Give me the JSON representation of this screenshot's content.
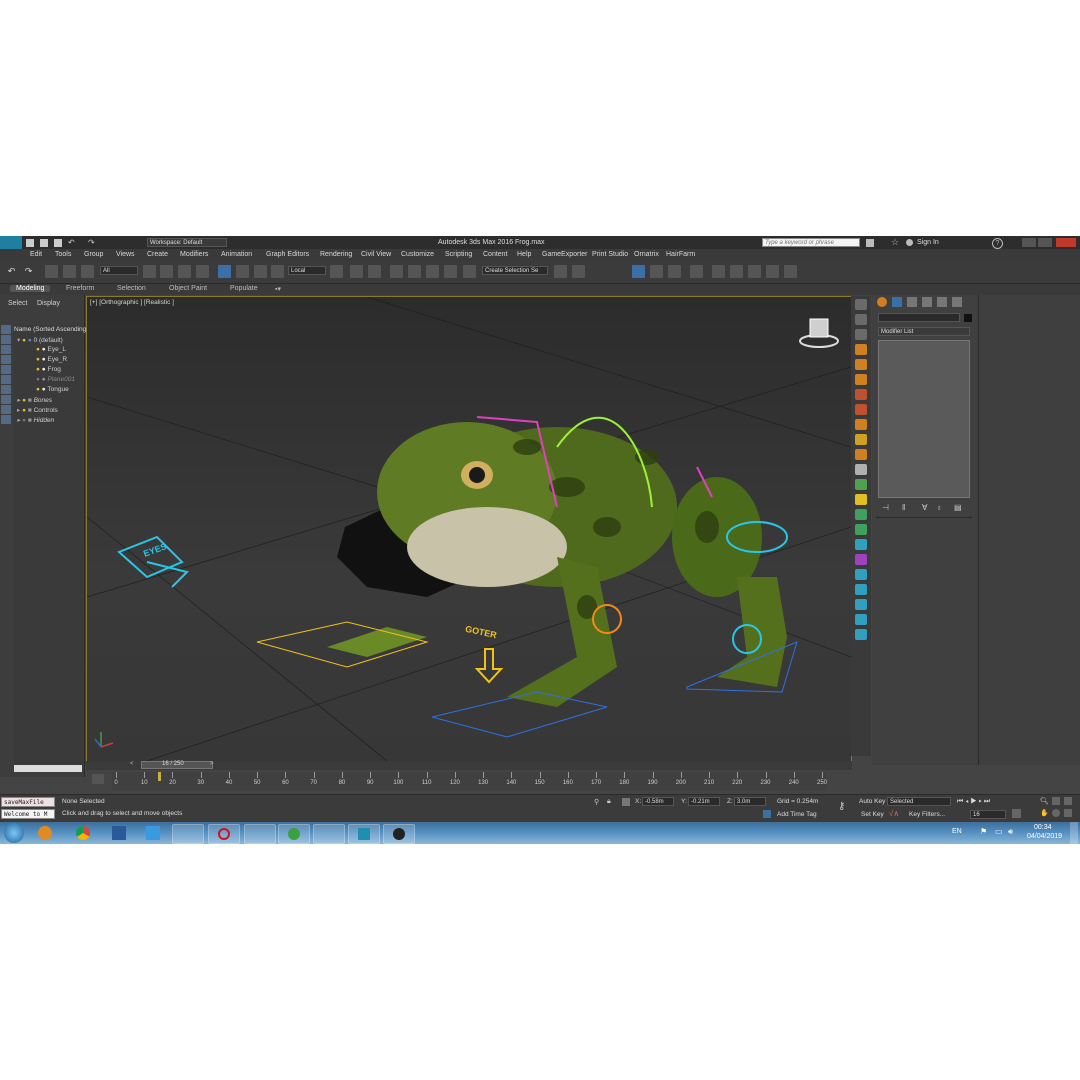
{
  "titlebar": {
    "workspace_label": "Workspace: Default",
    "app_title": "Autodesk 3ds Max 2016",
    "file_name": "Frog.max",
    "search_placeholder": "Type a keyword or phrase",
    "sign_in": "Sign In"
  },
  "menu": [
    "Edit",
    "Tools",
    "Group",
    "Views",
    "Create",
    "Modifiers",
    "Animation",
    "Graph Editors",
    "Rendering",
    "Civil View",
    "Customize",
    "Scripting",
    "Content",
    "Help",
    "GameExporter",
    "Print Studio",
    "Ornatrix",
    "HairFarm"
  ],
  "toolbar": {
    "selection_filter": "All",
    "coordinate_system": "Local",
    "selection_set": "Create Selection Se"
  },
  "ribbon": {
    "tabs": [
      "Modeling",
      "Freeform",
      "Selection",
      "Object Paint",
      "Populate"
    ]
  },
  "scene_explorer": {
    "tabs": [
      "Select",
      "Display"
    ],
    "header": "Name (Sorted Ascending)",
    "items": [
      "0 (default)",
      "Eye_L",
      "Eye_R",
      "Frog",
      "Plane001",
      "Tongue",
      "Bones",
      "Controls",
      "Hidden"
    ]
  },
  "viewport": {
    "label": "[+] [Orthographic ] [Realistic ]",
    "control_label_1": "EYES",
    "control_label_2": "GOTER"
  },
  "command_panel": {
    "modifier_list": "Modifier List"
  },
  "timeline": {
    "frame_indicator": "16 / 250",
    "ticks": [
      "0",
      "10",
      "20",
      "30",
      "40",
      "50",
      "60",
      "70",
      "80",
      "90",
      "100",
      "110",
      "120",
      "130",
      "140",
      "150",
      "160",
      "170",
      "180",
      "190",
      "200",
      "210",
      "220",
      "230",
      "240",
      "250"
    ]
  },
  "status": {
    "listener_1": "saveMaxFile",
    "listener_2": "Welcome to M",
    "selection_status": "None Selected",
    "prompt": "Click and drag to select and move objects",
    "x_value": "-0.58m",
    "y_value": "-0.21m",
    "z_value": "3.0m",
    "grid": "Grid = 0.254m",
    "add_time_tag": "Add Time Tag",
    "auto_key": "Auto Key",
    "selected": "Selected",
    "set_key": "Set Key",
    "key_filters": "Key Filters...",
    "current_frame": "16"
  },
  "taskbar": {
    "language": "EN",
    "time": "00:34",
    "date": "04/04/2019"
  },
  "colors": {
    "accent_blue": "#3b6fa8",
    "viewport_border": "#8a7a30",
    "ik_cyan": "#29c6e8",
    "ik_yellow": "#f2c21a",
    "ik_magenta": "#e040c0",
    "ik_green": "#9cf23a"
  }
}
